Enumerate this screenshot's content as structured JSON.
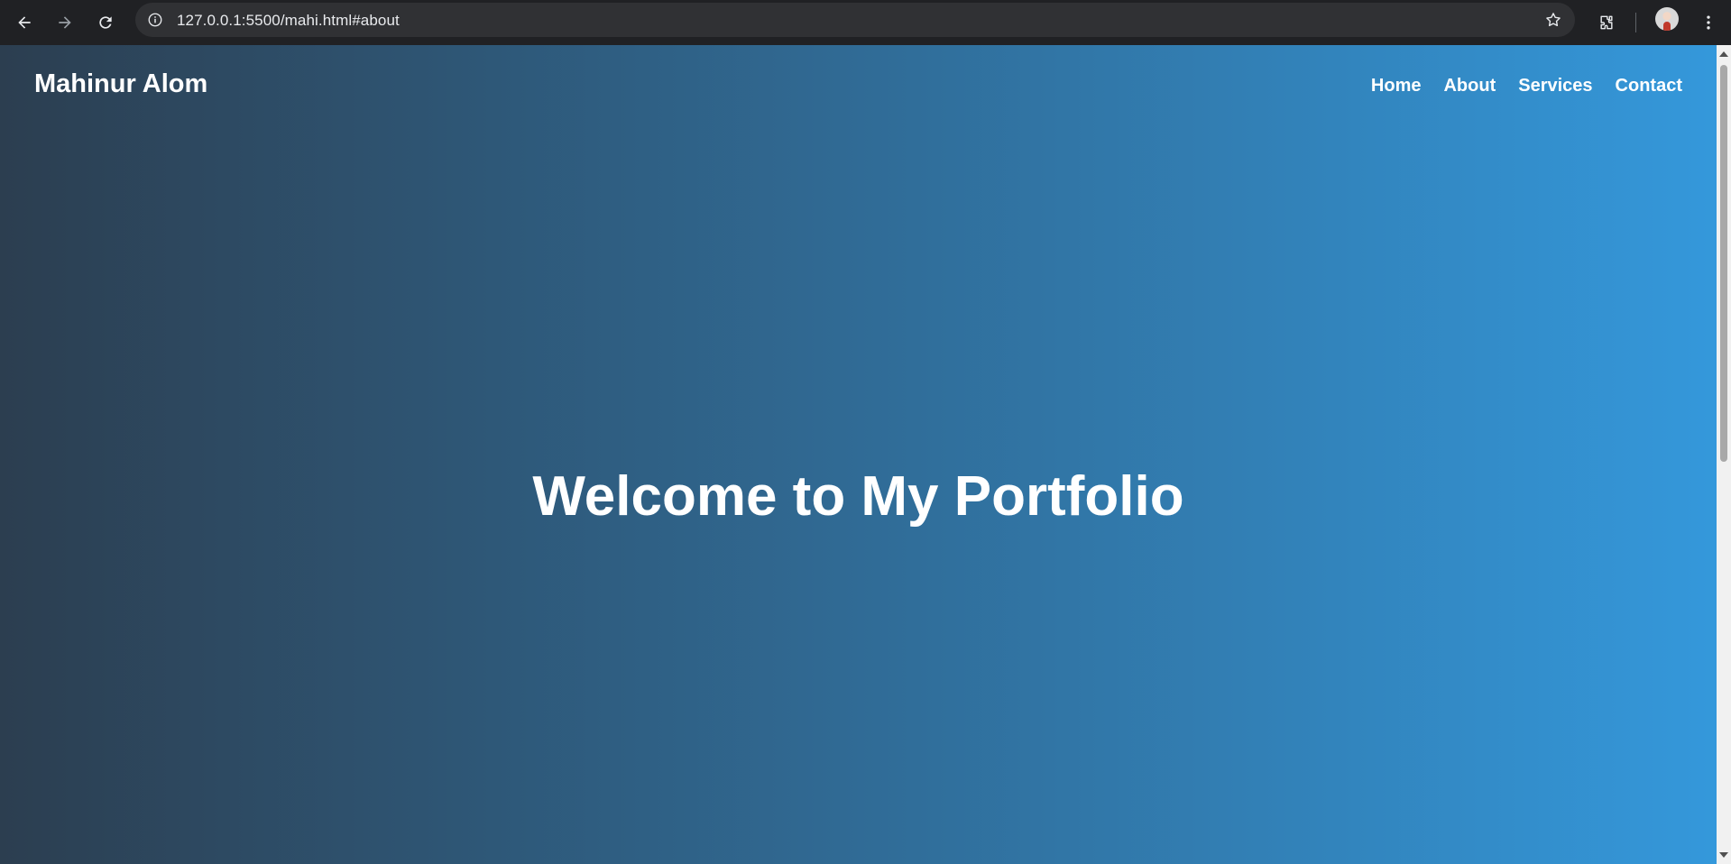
{
  "browser": {
    "url": "127.0.0.1:5500/mahi.html#about",
    "icons": {
      "back": "arrow-left-icon",
      "forward": "arrow-right-icon",
      "reload": "reload-icon",
      "site_info": "info-icon",
      "bookmark": "star-icon",
      "extensions": "puzzle-icon",
      "profile": "avatar",
      "menu": "kebab-menu-icon"
    }
  },
  "site": {
    "logo": "Mahinur Alom",
    "nav": [
      "Home",
      "About",
      "Services",
      "Contact"
    ],
    "hero_title": "Welcome to My Portfolio"
  },
  "colors": {
    "gradient_start": "#2c3e50",
    "gradient_end": "#3498db",
    "text": "#ffffff",
    "chrome_bg": "#202124",
    "omnibox_bg": "#303134"
  }
}
